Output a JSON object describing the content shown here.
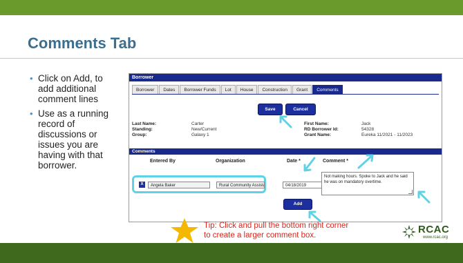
{
  "slide": {
    "title": "Comments Tab",
    "bullets": [
      "Click on Add, to add additional comment lines",
      "Use as a running record of discussions or issues you are having with that borrower."
    ],
    "tip_line1": "Tip: Click and pull the bottom right corner",
    "tip_line2": "to create a larger comment box.",
    "logo_text": "RCAC",
    "logo_url": "www.rcac.org"
  },
  "app": {
    "panel_title": "Borrower",
    "tabs": [
      "Borrower",
      "Dates",
      "Borrower Funds",
      "Lot",
      "House",
      "Construction",
      "Grant",
      "Comments"
    ],
    "active_tab": "Comments",
    "save_label": "Save",
    "cancel_label": "Cancel",
    "fields": {
      "last_name_label": "Last Name:",
      "last_name": "Carter",
      "standing_label": "Standing:",
      "standing": "New/Current",
      "group_label": "Group:",
      "group": "Galaxy 1",
      "first_name_label": "First Name:",
      "first_name": "Jack",
      "rd_id_label": "RD Borrower Id:",
      "rd_id": "54328",
      "grant_name_label": "Grant Name:",
      "grant_name": "Eureka 11/2021 - 11/2023"
    },
    "comments": {
      "header": "Comments",
      "col_entered_by": "Entered By",
      "col_organization": "Organization",
      "col_date": "Date *",
      "col_comment": "Comment *",
      "delete_label": "X",
      "entered_by": "Angela Baker",
      "organization": "Rural Community Assistance Cor",
      "date": "04/18/2019",
      "comment": "Not making hours.  Spoke to Jack and he said he was on mandatory overtime.",
      "add_label": "Add"
    }
  },
  "colors": {
    "top_bar": "#6a9a2c",
    "bottom_bar": "#3f6a1e",
    "title": "#3b6e8f",
    "app_header": "#1a2a8c",
    "highlight": "#5fd3e6",
    "tip": "#d9261c",
    "star": "#f5b800"
  },
  "icons": [
    "calendar-icon",
    "delete-icon",
    "resize-grip-icon",
    "star-icon",
    "rcac-logo-icon",
    "arrow-icon"
  ]
}
